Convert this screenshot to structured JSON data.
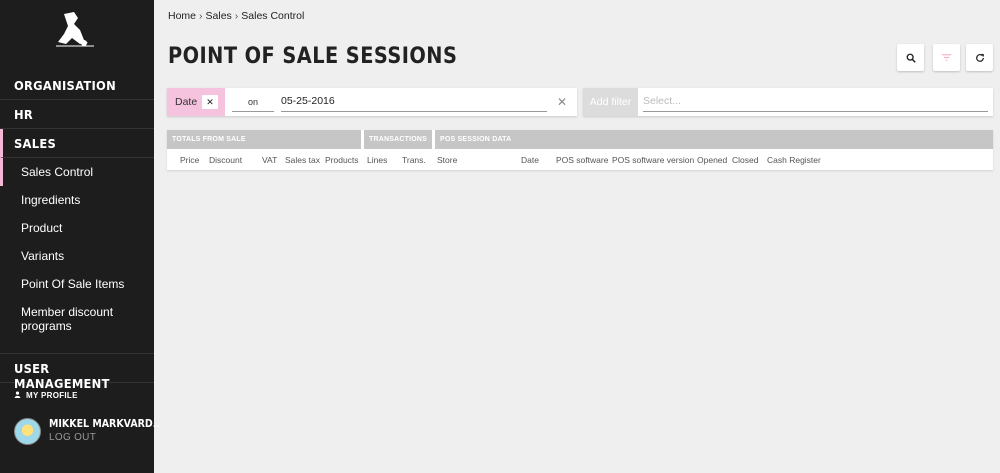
{
  "sidebar": {
    "sections": [
      {
        "label": "ORGANISATION"
      },
      {
        "label": "HR"
      },
      {
        "label": "SALES"
      }
    ],
    "sales_items": [
      {
        "label": "Sales Control"
      },
      {
        "label": "Ingredients"
      },
      {
        "label": "Product"
      },
      {
        "label": "Variants"
      },
      {
        "label": "Point Of Sale Items"
      },
      {
        "label": "Member discount programs"
      }
    ],
    "user_management": "USER MANAGEMENT",
    "my_profile": "MY PROFILE",
    "user_name": "MIKKEL MARKVARD..",
    "logout": "LOG OUT"
  },
  "breadcrumb": [
    "Home",
    "Sales",
    "Sales Control"
  ],
  "page_title": "POINT OF SALE SESSIONS",
  "toolbar": {
    "search_icon": "search-icon",
    "filter_icon": "filter-icon",
    "refresh_icon": "refresh-icon",
    "filter_accent": "#f4b8d6"
  },
  "filter": {
    "tag_label": "Date",
    "operator": "on",
    "value": "05-25-2016",
    "add_filter_label": "Add filter",
    "select_placeholder": "Select..."
  },
  "table": {
    "groups": [
      "TOTALS FROM SALE",
      "TRANSACTIONS",
      "POS SESSION DATA"
    ],
    "columns": [
      "Price",
      "Discount",
      "VAT",
      "Sales tax",
      "Products",
      "Lines",
      "Trans.",
      "Store",
      "Date",
      "POS software",
      "POS software version",
      "Opened",
      "Closed",
      "Cash Register"
    ]
  }
}
